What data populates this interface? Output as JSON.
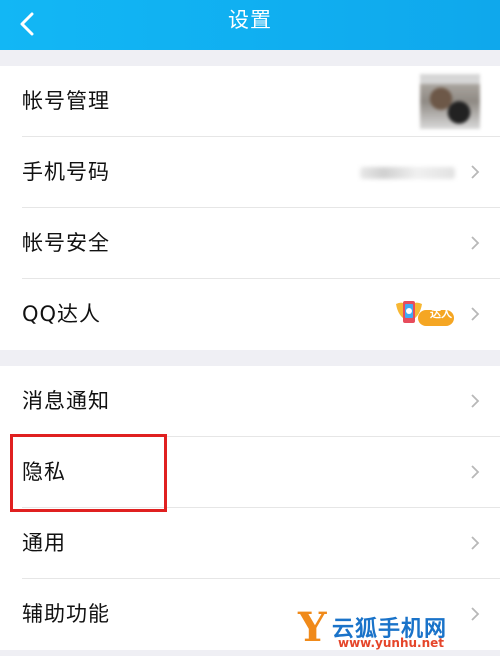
{
  "header": {
    "title": "设置",
    "back_icon": "chevron-left-icon"
  },
  "group1": [
    {
      "label": "帐号管理",
      "trailing": "avatar"
    },
    {
      "label": "手机号码",
      "trailing": "blurred-phone-number"
    },
    {
      "label": "帐号安全",
      "trailing": "chevron"
    },
    {
      "label": "QQ达人",
      "trailing": "daren-badge",
      "badge_text": "达人"
    }
  ],
  "group2": [
    {
      "label": "消息通知"
    },
    {
      "label": "隐私"
    },
    {
      "label": "通用"
    },
    {
      "label": "辅助功能"
    }
  ],
  "highlight": {
    "color": "#e02020",
    "target": "隐私"
  },
  "watermark": {
    "letter": "Y",
    "name": "云狐手机网",
    "url": "www.yunhu.net"
  },
  "colors": {
    "header": "#12b7f5",
    "background": "#efeff4",
    "chevron": "#b8b8b8"
  }
}
